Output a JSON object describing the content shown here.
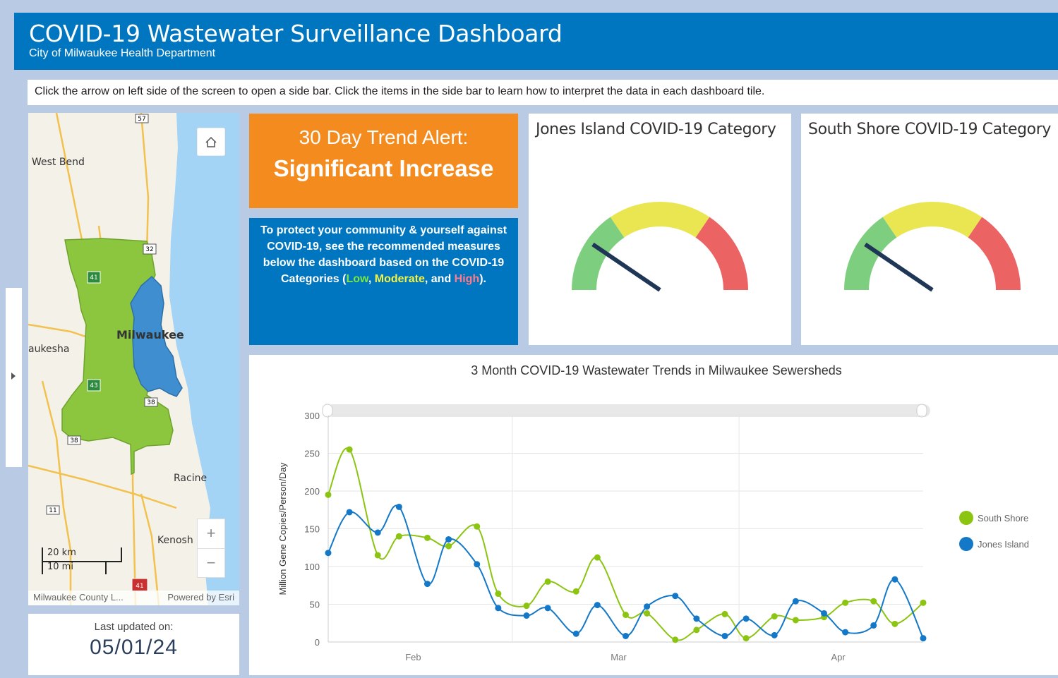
{
  "header": {
    "title": "COVID-19 Wastewater Surveillance Dashboard",
    "subtitle": "City of Milwaukee Health Department"
  },
  "instructions": "Click the arrow on left side of the screen to open a side bar. Click the items in the side bar to learn how to interpret the data in each dashboard tile.",
  "map": {
    "labels": {
      "west_bend": "West Bend",
      "milwaukee": "Milwaukee",
      "waukesha": "aukesha",
      "racine": "Racine",
      "kenosha": "Kenosh"
    },
    "route_shields": [
      "57",
      "32",
      "41",
      "43",
      "38",
      "38",
      "11",
      "41"
    ],
    "zoom_in": "+",
    "zoom_out": "−",
    "home_icon": "home-icon",
    "scale_km": "20 km",
    "scale_mi": "10 mi",
    "attribution_left": "Milwaukee County L...",
    "attribution_right": "Powered by Esri",
    "colors": {
      "green_sewershed": "#8cc63f",
      "blue_sewershed": "#3e8ed0",
      "water": "#a3d3f5"
    }
  },
  "updated": {
    "label": "Last updated on:",
    "date": "05/01/24"
  },
  "alert": {
    "line1": "30 Day Trend Alert:",
    "line2": "Significant Increase",
    "color": "#f48b1f"
  },
  "protect": {
    "text_before": "To protect your community & yourself against COVID-19, see the recommended measures below the dashboard based on the COVID-19 Categories (",
    "low": "Low",
    "sep1": ", ",
    "moderate": "Moderate",
    "sep2": ", and ",
    "high": "High",
    "text_after": ")."
  },
  "gauges": [
    {
      "title": "Jones Island COVID-19 Category",
      "needle_fraction": 0.19
    },
    {
      "title": "South Shore COVID-19 Category",
      "needle_fraction": 0.19
    }
  ],
  "gauge_colors": {
    "low": "#7dcf7f",
    "moderate": "#e9e652",
    "high": "#eb6363",
    "needle": "#1f3656"
  },
  "chart_data": {
    "type": "line",
    "title": "3 Month COVID-19 Wastewater Trends in Milwaukee Sewersheds",
    "ylabel": "Million Gene Copies/Person/Day",
    "xlabel": "",
    "ylim": [
      0,
      300
    ],
    "yticks": [
      0,
      50,
      100,
      150,
      200,
      250,
      300
    ],
    "x_tick_labels": [
      {
        "label": "Feb",
        "day": 31
      },
      {
        "label": "Mar",
        "day": 60
      },
      {
        "label": "Apr",
        "day": 91
      }
    ],
    "x_range": [
      19,
      100
    ],
    "grid": true,
    "legend_position": "right",
    "series": [
      {
        "name": "South Shore",
        "color": "#8cc412",
        "points": [
          [
            19,
            195
          ],
          [
            22,
            255
          ],
          [
            26,
            115
          ],
          [
            29,
            140
          ],
          [
            33,
            138
          ],
          [
            36,
            127
          ],
          [
            40,
            153
          ],
          [
            43,
            64
          ],
          [
            47,
            48
          ],
          [
            50,
            80
          ],
          [
            54,
            67
          ],
          [
            57,
            112
          ],
          [
            61,
            36
          ],
          [
            64,
            38
          ],
          [
            68,
            3
          ],
          [
            71,
            16
          ],
          [
            75,
            37
          ],
          [
            78,
            5
          ],
          [
            82,
            34
          ],
          [
            85,
            29
          ],
          [
            89,
            33
          ],
          [
            92,
            52
          ],
          [
            96,
            54
          ],
          [
            99,
            24
          ],
          [
            103,
            52
          ]
        ]
      },
      {
        "name": "Jones Island",
        "color": "#1478c8",
        "points": [
          [
            19,
            118
          ],
          [
            22,
            172
          ],
          [
            26,
            145
          ],
          [
            29,
            179
          ],
          [
            33,
            77
          ],
          [
            36,
            136
          ],
          [
            40,
            103
          ],
          [
            43,
            45
          ],
          [
            47,
            35
          ],
          [
            50,
            45
          ],
          [
            54,
            11
          ],
          [
            57,
            49
          ],
          [
            61,
            8
          ],
          [
            64,
            47
          ],
          [
            68,
            61
          ],
          [
            71,
            31
          ],
          [
            75,
            8
          ],
          [
            78,
            31
          ],
          [
            82,
            9
          ],
          [
            85,
            54
          ],
          [
            89,
            38
          ],
          [
            92,
            13
          ],
          [
            96,
            22
          ],
          [
            99,
            83
          ],
          [
            103,
            5
          ]
        ]
      }
    ]
  }
}
